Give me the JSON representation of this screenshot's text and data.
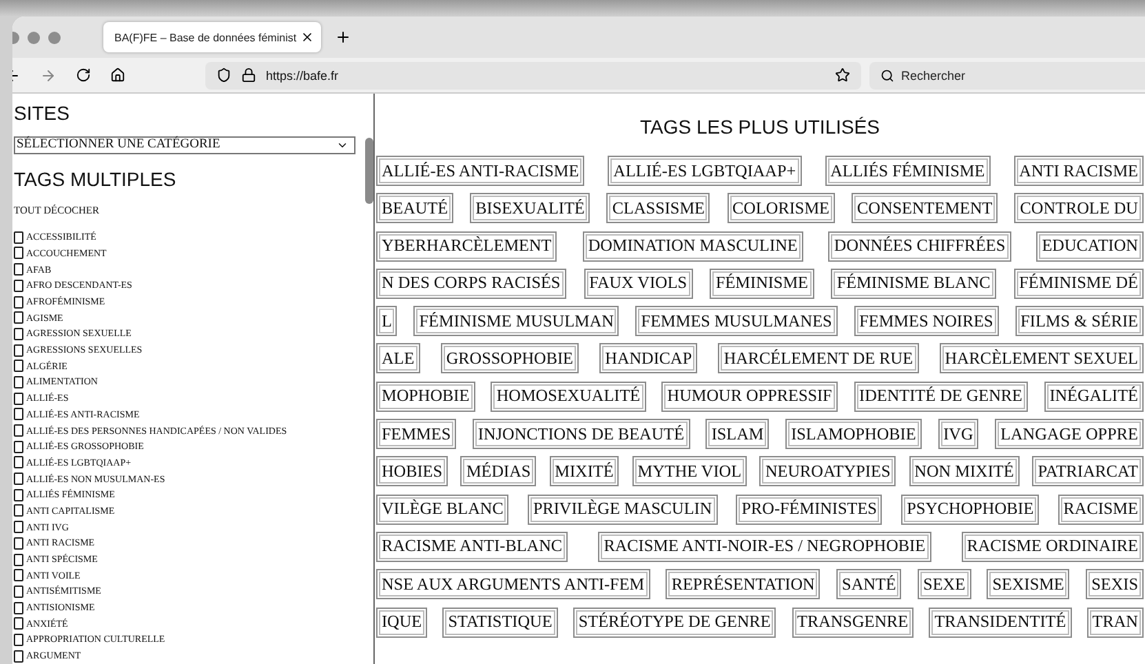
{
  "browser": {
    "tab": {
      "title": "BA(F)FE – Base de données féminist",
      "selected": true
    },
    "url": "https://bafe.fr",
    "search": {
      "placeholder": "Rechercher"
    }
  },
  "sidebar": {
    "sites_heading": "SITES",
    "category_select": "SÉLECTIONNER UNE CATÉGORIE",
    "tags_heading": "TAGS MULTIPLES",
    "uncheck_all": "TOUT DÉCOCHER",
    "tags": [
      {
        "label": "ACCESSIBILITÉ",
        "checked": false
      },
      {
        "label": "ACCOUCHEMENT",
        "checked": false
      },
      {
        "label": "AFAB",
        "checked": false
      },
      {
        "label": "AFRO DESCENDANT-ES",
        "checked": false
      },
      {
        "label": "AFROFÉMINISME",
        "checked": false
      },
      {
        "label": "AGISME",
        "checked": false
      },
      {
        "label": "AGRESSION SEXUELLE",
        "checked": false
      },
      {
        "label": "AGRESSIONS SEXUELLES",
        "checked": false
      },
      {
        "label": "ALGÉRIE",
        "checked": false
      },
      {
        "label": "ALIMENTATION",
        "checked": false
      },
      {
        "label": "ALLIÉ-ES",
        "checked": false
      },
      {
        "label": "ALLIÉ-ES ANTI-RACISME",
        "checked": false
      },
      {
        "label": "ALLIÉ-ES DES PERSONNES HANDICAPÉES / NON VALIDES",
        "checked": false
      },
      {
        "label": "ALLIÉ-ES GROSSOPHOBIE",
        "checked": false
      },
      {
        "label": "ALLIÉ-ES LGBTQIAAP+",
        "checked": false
      },
      {
        "label": "ALLIÉ-ES NON MUSULMAN-ES",
        "checked": false
      },
      {
        "label": "ALLIÉS FÉMINISME",
        "checked": false
      },
      {
        "label": "ANTI CAPITALISME",
        "checked": false
      },
      {
        "label": "ANTI IVG",
        "checked": false
      },
      {
        "label": "ANTI RACISME",
        "checked": false
      },
      {
        "label": "ANTI SPÉCISME",
        "checked": false
      },
      {
        "label": "ANTI VOILE",
        "checked": false
      },
      {
        "label": "ANTISÉMITISME",
        "checked": false
      },
      {
        "label": "ANTISIONISME",
        "checked": false
      },
      {
        "label": "ANXIÉTÉ",
        "checked": false
      },
      {
        "label": "APPROPRIATION CULTURELLE",
        "checked": false
      },
      {
        "label": "ARGUMENT",
        "checked": false
      }
    ]
  },
  "main": {
    "title": "TAGS LES PLUS UTILISÉS",
    "tag_rows": [
      [
        "ALLIÉ-ES ANTI-RACISME",
        "ALLIÉ-ES LGBTQIAAP+",
        "ALLIÉS FÉMINISME",
        "ANTI RACISME"
      ],
      [
        "BEAUTÉ",
        "BISEXUALITÉ",
        "CLASSISME",
        "COLORISME",
        "CONSENTEMENT",
        "CONTROLE DU"
      ],
      [
        "YBERHARCÈLEMENT",
        "DOMINATION MASCULINE",
        "DONNÉES CHIFFRÉES",
        "EDUCATION"
      ],
      [
        "N DES CORPS RACISÉS",
        "FAUX VIOLS",
        "FÉMINISME",
        "FÉMINISME BLANC",
        "FÉMINISME DÉ"
      ],
      [
        "L",
        "FÉMINISME MUSULMAN",
        "FEMMES MUSULMANES",
        "FEMMES NOIRES",
        "FILMS & SÉRIE"
      ],
      [
        "ALE",
        "GROSSOPHOBIE",
        "HANDICAP",
        "HARCÉLEMENT DE RUE",
        "HARCÈLEMENT SEXUEL"
      ],
      [
        "MOPHOBIE",
        "HOMOSEXUALITÉ",
        "HUMOUR OPPRESSIF",
        "IDENTITÉ DE GENRE",
        "INÉGALITÉ"
      ],
      [
        "FEMMES",
        "INJONCTIONS DE BEAUTÉ",
        "ISLAM",
        "ISLAMOPHOBIE",
        "IVG",
        "LANGAGE OPPRE"
      ],
      [
        "HOBIES",
        "MÉDIAS",
        "MIXITÉ",
        "MYTHE VIOL",
        "NEUROATYPIES",
        "NON MIXITÉ",
        "PATRIARCAT"
      ],
      [
        "VILÈGE BLANC",
        "PRIVILÈGE MASCULIN",
        "PRO-FÉMINISTES",
        "PSYCHOPHOBIE",
        "RACISME"
      ],
      [
        "RACISME ANTI-BLANC",
        "RACISME ANTI-NOIR-ES / NEGROPHOBIE",
        "RACISME ORDINAIRE"
      ],
      [
        "NSE AUX ARGUMENTS ANTI-FEM",
        "REPRÉSENTATION",
        "SANTÉ",
        "SEXE",
        "SEXISME",
        "SEXIS"
      ],
      [
        "IQUE",
        "STATISTIQUE",
        "STÉRÉOTYPE DE GENRE",
        "TRANSGENRE",
        "TRANSIDENTITÉ",
        "TRAN"
      ]
    ]
  }
}
